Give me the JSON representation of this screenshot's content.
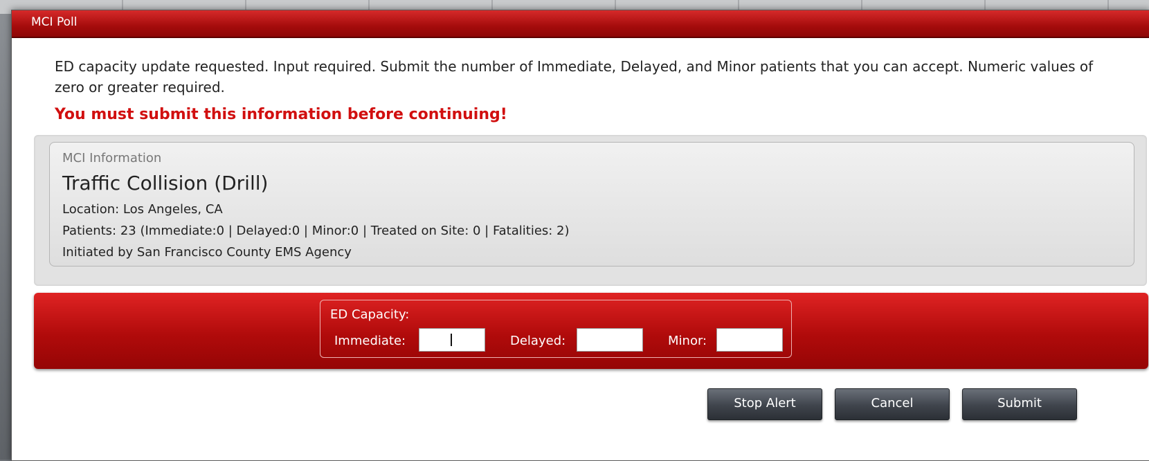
{
  "window": {
    "title": "MCI Poll"
  },
  "message": {
    "instructions": "ED capacity update requested. Input required. Submit the number of Immediate, Delayed, and Minor patients that you can accept. Numeric values of zero or greater required.",
    "warning": "You must submit this information before continuing!"
  },
  "mci_info": {
    "heading": "MCI Information",
    "title": "Traffic Collision (Drill)",
    "location": "Location: Los Angeles, CA",
    "patients": "Patients: 23 (Immediate:0 | Delayed:0 | Minor:0 |  Treated on Site: 0 | Fatalities: 2)",
    "initiated_by": "Initiated by San Francisco County EMS Agency"
  },
  "ed_capacity": {
    "title": "ED Capacity:",
    "immediate_label": "Immediate:",
    "immediate_value": "",
    "delayed_label": "Delayed:",
    "delayed_value": "",
    "minor_label": "Minor:",
    "minor_value": ""
  },
  "buttons": {
    "stop_alert": "Stop Alert",
    "cancel": "Cancel",
    "submit": "Submit"
  },
  "colors": {
    "titlebar": "#a50c0c",
    "warning_text": "#d10f0f",
    "panel_red": "#b10b0b",
    "button_dark": "#3f444c"
  }
}
